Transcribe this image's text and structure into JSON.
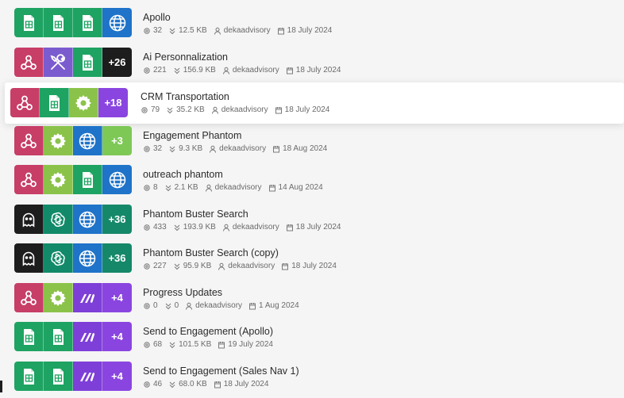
{
  "colors": {
    "sheets": "#1ea362",
    "webhook": "#c73e67",
    "tools": "#7b5ccf",
    "globe": "#1f73c9",
    "settings": "#8bc34a",
    "openai": "#128a6a",
    "phantom": "#1d1d1d",
    "make": "#7e3fd8",
    "count_dark": "#1d1d1d",
    "count_purple": "#8a45e0",
    "count_green": "#7ec856",
    "count_teal": "#16886a"
  },
  "scenarios": [
    {
      "name": "Apollo",
      "operations": "32",
      "transfer": "12.5 KB",
      "owner": "dekaadvisory",
      "date": "18 July 2024",
      "tiles": [
        {
          "icon": "sheets-icon"
        },
        {
          "icon": "sheets-icon"
        },
        {
          "icon": "sheets-icon"
        },
        {
          "icon": "globe-icon"
        }
      ]
    },
    {
      "name": "Ai Personnalization",
      "operations": "221",
      "transfer": "156.9 KB",
      "owner": "dekaadvisory",
      "date": "18 July 2024",
      "tiles": [
        {
          "icon": "webhook-icon"
        },
        {
          "icon": "tools-icon"
        },
        {
          "icon": "sheets-icon"
        },
        {
          "count": "+26",
          "color": "count_dark"
        }
      ]
    },
    {
      "name": "CRM Transportation",
      "operations": "79",
      "transfer": "35.2 KB",
      "owner": "dekaadvisory",
      "date": "18 July 2024",
      "highlight": true,
      "tiles": [
        {
          "icon": "webhook-icon"
        },
        {
          "icon": "sheets-icon"
        },
        {
          "icon": "settings-icon"
        },
        {
          "count": "+18",
          "color": "count_purple"
        }
      ]
    },
    {
      "name": "Engagement Phantom",
      "operations": "32",
      "transfer": "9.3 KB",
      "owner": "dekaadvisory",
      "date": "18 Aug 2024",
      "tiles": [
        {
          "icon": "webhook-icon"
        },
        {
          "icon": "settings-icon"
        },
        {
          "icon": "globe-icon"
        },
        {
          "count": "+3",
          "color": "count_green"
        }
      ]
    },
    {
      "name": "outreach phantom",
      "operations": "8",
      "transfer": "2.1 KB",
      "owner": "dekaadvisory",
      "date": "14 Aug 2024",
      "tiles": [
        {
          "icon": "webhook-icon"
        },
        {
          "icon": "settings-icon"
        },
        {
          "icon": "sheets-icon"
        },
        {
          "icon": "globe-icon"
        }
      ]
    },
    {
      "name": "Phantom Buster Search",
      "operations": "433",
      "transfer": "193.9 KB",
      "owner": "dekaadvisory",
      "date": "18 July 2024",
      "tiles": [
        {
          "icon": "phantom-icon"
        },
        {
          "icon": "openai-icon"
        },
        {
          "icon": "globe-icon"
        },
        {
          "count": "+36",
          "color": "count_teal"
        }
      ]
    },
    {
      "name": "Phantom Buster Search (copy)",
      "operations": "227",
      "transfer": "95.9 KB",
      "owner": "dekaadvisory",
      "date": "18 July 2024",
      "tiles": [
        {
          "icon": "phantom-icon"
        },
        {
          "icon": "openai-icon"
        },
        {
          "icon": "globe-icon"
        },
        {
          "count": "+36",
          "color": "count_teal"
        }
      ]
    },
    {
      "name": "Progress Updates",
      "operations": "0",
      "transfer": "0",
      "owner": "dekaadvisory",
      "date": "1 Aug 2024",
      "tiles": [
        {
          "icon": "webhook-icon"
        },
        {
          "icon": "settings-icon"
        },
        {
          "icon": "make-icon"
        },
        {
          "count": "+4",
          "color": "count_purple"
        }
      ]
    },
    {
      "name": "Send to Engagement (Apollo)",
      "operations": "68",
      "transfer": "101.5 KB",
      "owner": "",
      "date": "19 July 2024",
      "tiles": [
        {
          "icon": "sheets-icon"
        },
        {
          "icon": "sheets-icon"
        },
        {
          "icon": "make-icon"
        },
        {
          "count": "+4",
          "color": "count_purple"
        }
      ]
    },
    {
      "name": "Send to Engagement (Sales Nav 1)",
      "operations": "46",
      "transfer": "68.0 KB",
      "owner": "",
      "date": "18 July 2024",
      "tiles": [
        {
          "icon": "sheets-icon"
        },
        {
          "icon": "sheets-icon"
        },
        {
          "icon": "make-icon"
        },
        {
          "count": "+4",
          "color": "count_purple"
        }
      ]
    }
  ]
}
